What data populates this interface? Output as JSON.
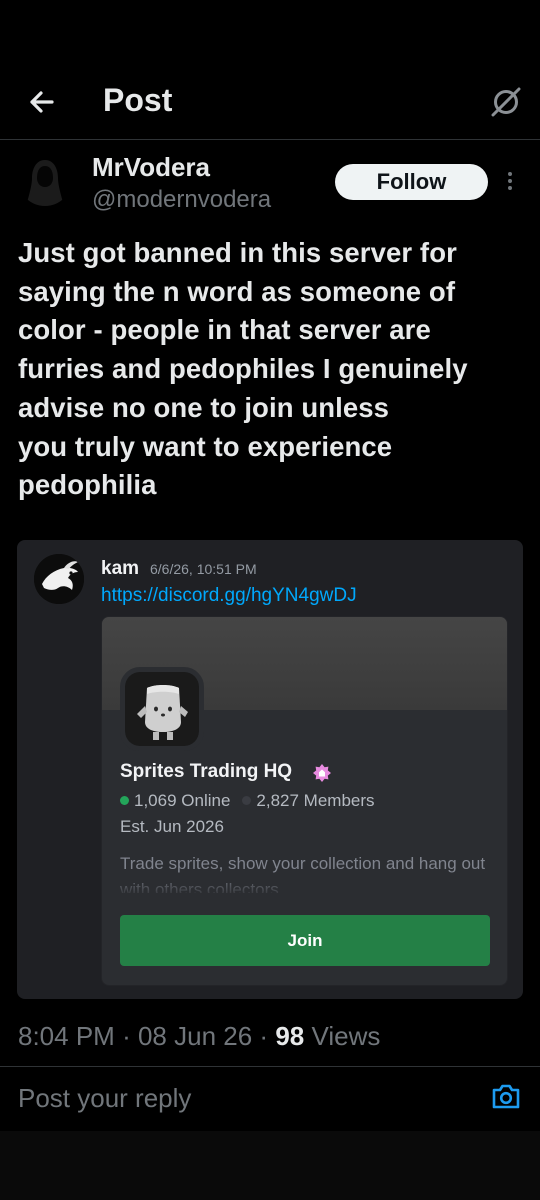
{
  "header": {
    "title": "Post",
    "back_icon": "arrow-left-icon",
    "grok_icon": "grok-icon"
  },
  "author": {
    "name": "MrVodera",
    "handle": "@modernvodera",
    "follow_label": "Follow",
    "more_icon": "more-vertical-icon"
  },
  "post": {
    "lines": [
      "Just got banned in this server for",
      "saying the n word as someone of",
      "color - people in that server are",
      "furries and pedophiles I genuinely",
      "advise no one to join unless",
      "you truly want to experience",
      "pedophilia"
    ]
  },
  "embed": {
    "username": "kam",
    "timestamp": "6/6/26, 10:51 PM",
    "link": "https://discord.gg/hgYN4gwDJ",
    "invite": {
      "server_name": "Sprites Trading HQ",
      "online": "1,069 Online",
      "members": "2,827 Members",
      "established": "Est. Jun 2026",
      "description": "Trade sprites, show your collection and hang out with others collectors",
      "join_label": "Join",
      "online_color": "#23a55a",
      "join_color": "#248046"
    }
  },
  "meta": {
    "time": "8:04 PM",
    "separator": "·",
    "date": "08 Jun 26",
    "views_count": "98",
    "views_label": "Views"
  },
  "reply": {
    "placeholder": "Post your reply",
    "camera_icon": "camera-icon",
    "accent": "#1d9bf0"
  }
}
